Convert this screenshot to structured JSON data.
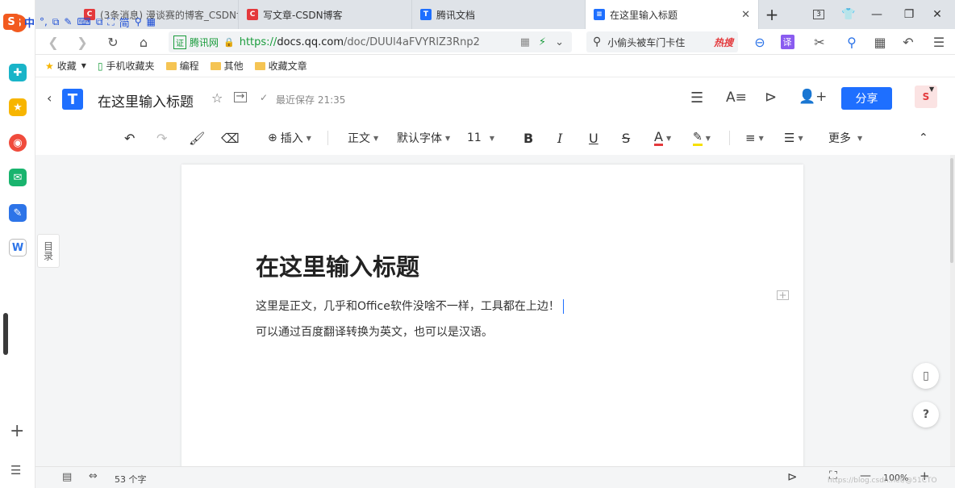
{
  "ime": {
    "brand": "S",
    "items": [
      "中",
      "°,",
      "⧉",
      "✎",
      "⌨",
      "⧉",
      "⛶",
      "简",
      "⚲",
      "▦"
    ]
  },
  "tabs": [
    {
      "label": "(3条消息) 漫谈赛的博客_CSDN博客",
      "active": false
    },
    {
      "label": "写文章-CSDN博客",
      "active": false
    },
    {
      "label": "腾讯文档",
      "active": false
    },
    {
      "label": "在这里输入标题",
      "active": true
    }
  ],
  "tab_count": "3",
  "url": {
    "badge": "证",
    "site": "腾讯网",
    "scheme": "https://",
    "host": "docs.qq.com",
    "path": "/doc/DUUl4aFVYRlZ3Rnp2"
  },
  "search": {
    "text": "小偷头被车门卡住",
    "hot": "热搜"
  },
  "bookmarks": [
    {
      "label": "收藏",
      "type": "star"
    },
    {
      "label": "手机收藏夹",
      "type": "phone"
    },
    {
      "label": "编程",
      "type": "folder"
    },
    {
      "label": "其他",
      "type": "folder"
    },
    {
      "label": "收藏文章",
      "type": "folder"
    }
  ],
  "doc": {
    "title": "在这里输入标题",
    "save_status": "最近保存 21:35",
    "share_label": "分享"
  },
  "toolbar": {
    "insert": "插入",
    "style": "正文",
    "font": "默认字体",
    "size": "11",
    "more": "更多"
  },
  "toc_label": "目录",
  "content": {
    "heading": "在这里输入标题",
    "paragraphs": [
      "这里是正文，几乎和Office软件没啥不一样，工具都在上边！",
      "可以通过百度翻译转换为英文，也可以是汉语。"
    ]
  },
  "status": {
    "word_count": "53 个字",
    "zoom": "100%"
  },
  "watermark": "https://blog.csdn.net/@51CTO博客",
  "colors": {
    "accent": "#1e6fff",
    "brand_red": "#e4393c",
    "url_green": "#1a9c3c"
  }
}
